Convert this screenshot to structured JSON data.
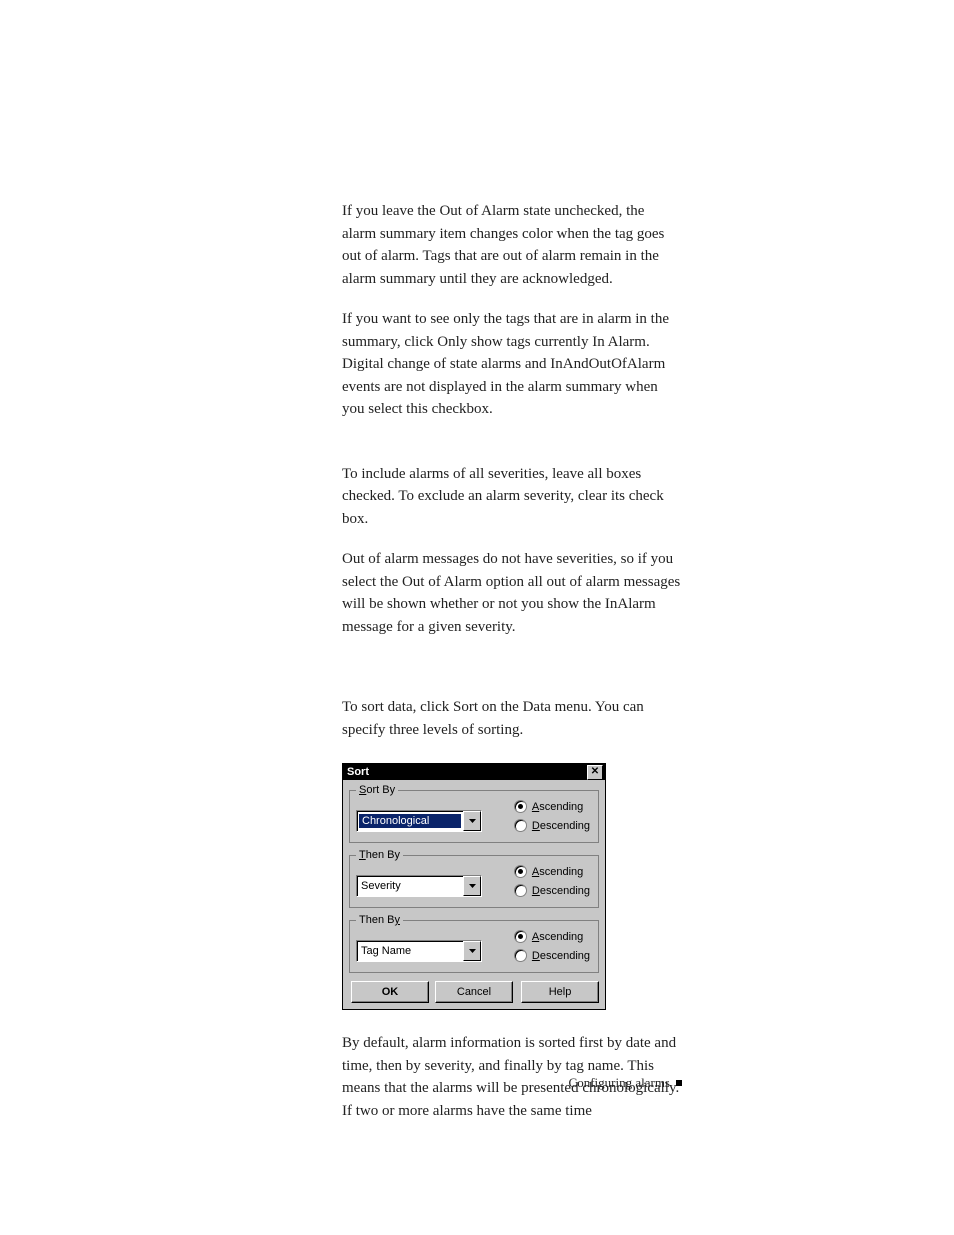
{
  "paragraphs": {
    "p1": "If you leave the Out of Alarm state unchecked, the alarm summary item changes color when the tag goes out of alarm. Tags that are out of alarm remain in the alarm summary until they are acknowledged.",
    "p2": "If you want to see only the tags that are in alarm in the summary, click Only show tags currently In Alarm. Digital change of state alarms and InAndOutOfAlarm events are not displayed in the alarm summary when you select this checkbox.",
    "p3": "To include alarms of all severities, leave all boxes checked. To exclude an alarm severity, clear its check box.",
    "p4": "Out of alarm messages do not have severities, so if you select the Out of Alarm option all out of alarm messages will be shown whether or not you show the InAlarm message for a given severity.",
    "p5": "To sort data, click Sort on the Data menu. You can specify three levels of sorting.",
    "p6": "By default, alarm information is sorted first by date and time, then by severity, and finally by tag name. This means that the alarms will be presented chronologically. If two or more alarms have the same time"
  },
  "dialog": {
    "title": "Sort",
    "close_glyph": "✕",
    "groups": [
      {
        "legend_pre": "S",
        "legend_rest": "ort By",
        "combo_value": "Chronological",
        "combo_selected": true,
        "asc_pre": "A",
        "asc_rest": "scending",
        "desc_pre": "D",
        "desc_rest": "escending",
        "selected": "asc"
      },
      {
        "legend_pre": "T",
        "legend_rest": "hen By",
        "combo_value": "Severity",
        "combo_selected": false,
        "asc_pre": "A",
        "asc_rest": "scending",
        "desc_pre": "D",
        "desc_rest": "escending",
        "selected": "asc"
      },
      {
        "legend_pre": "",
        "legend_rest_pre": "Then B",
        "legend_u": "y",
        "combo_value": "Tag Name",
        "combo_selected": false,
        "asc_pre": "A",
        "asc_rest": "scending",
        "desc_pre": "D",
        "desc_rest": "escending",
        "selected": "asc"
      }
    ],
    "buttons": {
      "ok": "OK",
      "cancel": "Cancel",
      "help": "Help"
    }
  },
  "footer": {
    "text": "Configuring alarms"
  }
}
